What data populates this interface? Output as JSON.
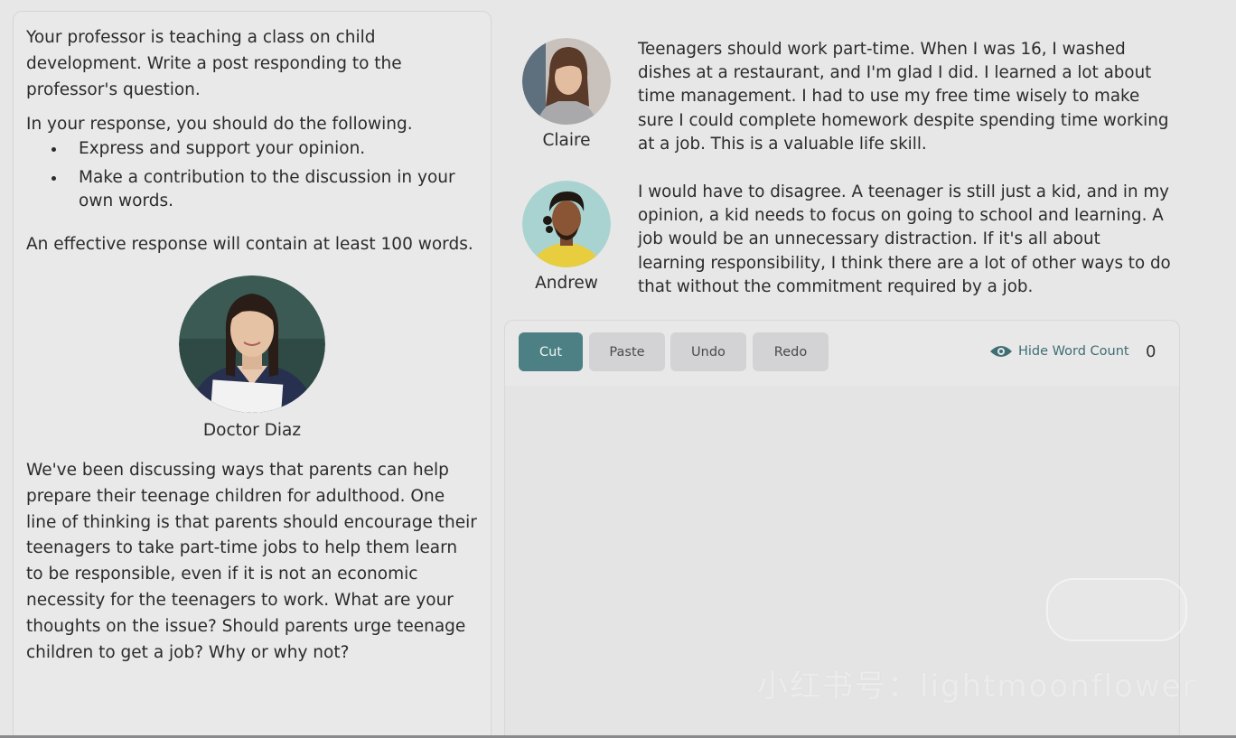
{
  "prompt": {
    "intro": "Your professor is teaching a class on child development. Write a post responding to the professor's question.",
    "instructions_heading": "In your response, you should do the following.",
    "requirements": [
      "Express and support your opinion.",
      "Make a contribution to the discussion in your own words."
    ],
    "word_requirement": "An effective response will contain at least 100 words."
  },
  "professor": {
    "name": "Doctor Diaz",
    "question": "We've been discussing ways that parents can help prepare their teenage children for adulthood. One line of thinking is that parents should encourage their teenagers to take part-time jobs to help them learn to be responsible, even if it is not an economic necessity for the teenagers to work. What are your thoughts on the issue? Should parents urge teenage children to get a job? Why or why not?"
  },
  "posts": [
    {
      "author": "Claire",
      "text": "Teenagers should work part-time. When I was 16, I washed dishes at a restaurant, and I'm glad I did. I learned a lot about time management. I had to use my free time wisely to make sure I could complete homework despite spending time working at a job. This is a valuable life skill."
    },
    {
      "author": "Andrew",
      "text": "I would have to disagree. A teenager is still just a kid, and in my opinion, a kid needs to focus on going to school and learning. A job would be an unnecessary distraction. If it's all about learning responsibility, I think there are a lot of other ways to do that without the commitment required by a job."
    }
  ],
  "editor": {
    "cut_label": "Cut",
    "paste_label": "Paste",
    "undo_label": "Undo",
    "redo_label": "Redo",
    "word_count_toggle_label": "Hide Word Count",
    "word_count": "0",
    "response_text": ""
  },
  "watermark": "小红书号：lightmoonflower",
  "colors": {
    "accent": "#4d8084",
    "background": "#e7e7e8"
  }
}
